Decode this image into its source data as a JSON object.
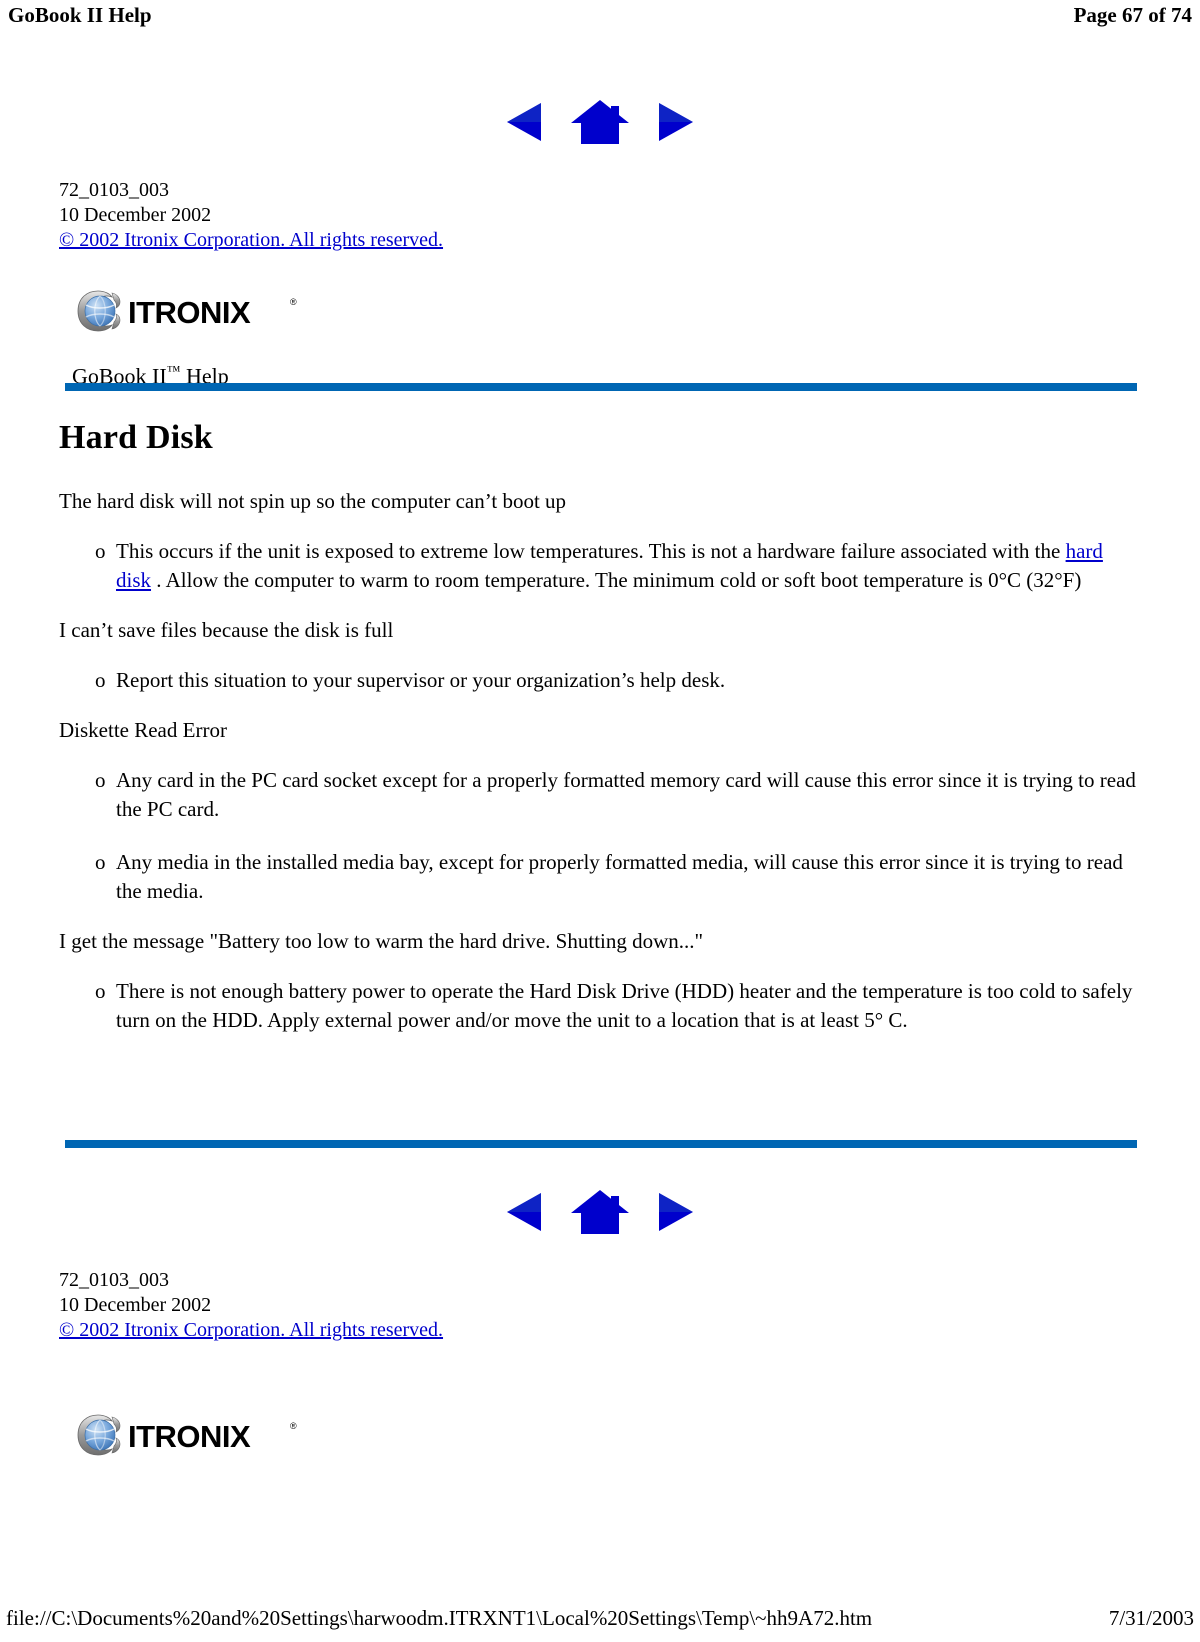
{
  "header": {
    "left_title": "GoBook II Help",
    "page_indicator": "Page 67 of 74"
  },
  "nav": {
    "back_icon": "left-triangle-icon",
    "home_icon": "home-icon",
    "forward_icon": "right-triangle-icon"
  },
  "document_meta": {
    "doc_number": "72_0103_003",
    "date": "10 December 2002",
    "copyright": "© 2002 Itronix Corporation.  All rights reserved."
  },
  "logo": {
    "wordmark": "ITRONIX",
    "registered_mark": "®",
    "globe_icon": "itronix-globe-icon"
  },
  "help_title": {
    "name": "GoBook II",
    "trademark": "™",
    "suffix": " Help"
  },
  "content": {
    "section_title": "Hard Disk",
    "blocks": [
      {
        "lead": "The hard disk will not spin up so the computer can’t boot up",
        "bullets": [
          {
            "pre": "This occurs if the unit is exposed to extreme low temperatures. This is not a hardware failure associated with the ",
            "link": "hard disk",
            "post": " .  Allow the computer to warm to room temperature.  The minimum cold or soft boot temperature is 0°C (32°F)"
          }
        ]
      },
      {
        "lead": "I can’t save files because the disk is full",
        "bullets": [
          {
            "pre": "Report this situation to your supervisor or your organization’s help desk.",
            "link": "",
            "post": ""
          }
        ]
      },
      {
        "lead": "Diskette Read Error",
        "bullets": [
          {
            "pre": "Any card in the PC card socket except for a properly formatted memory card will cause this error since it is trying to read the PC card.",
            "link": "",
            "post": ""
          },
          {
            "pre": "Any media in the installed media bay, except for properly formatted media, will cause this error since it is trying to read the media.",
            "link": "",
            "post": ""
          }
        ]
      },
      {
        "lead": "I get the message \"Battery too low to warm the hard drive.  Shutting down...\"",
        "bullets": [
          {
            "pre": "There is not enough battery power to operate the Hard Disk Drive (HDD) heater and the temperature is too cold to safely turn on the HDD.  Apply external power and/or move the unit to a location that is at least 5° C.",
            "link": "",
            "post": ""
          }
        ]
      }
    ],
    "bullet_glyph": "o"
  },
  "footer": {
    "file_path": "file://C:\\Documents%20and%20Settings\\harwoodm.ITRXNT1\\Local%20Settings\\Temp\\~hh9A72.htm",
    "print_date": "7/31/2003"
  },
  "colors": {
    "rule_blue": "#0066b3",
    "link_blue": "#0000cc",
    "nav_blue": "#0000cc"
  }
}
